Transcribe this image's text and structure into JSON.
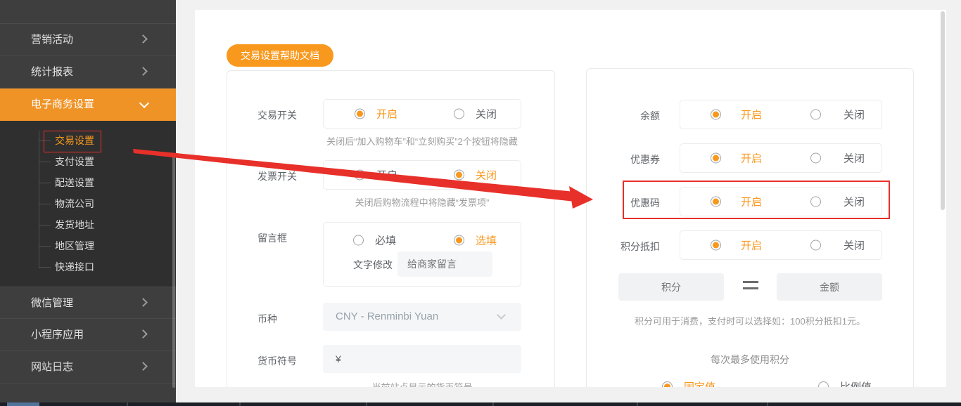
{
  "colors": {
    "accent": "#f8981d",
    "sidebar_active_bg": "#f09326",
    "annotation_red": "#e8302a"
  },
  "sidebar": {
    "items_top": [
      {
        "label": "营销活动"
      },
      {
        "label": "统计报表"
      }
    ],
    "active_item": {
      "label": "电子商务设置",
      "expanded": true
    },
    "submenu": [
      {
        "label": "交易设置",
        "current": true,
        "annotated": true
      },
      {
        "label": "支付设置"
      },
      {
        "label": "配送设置"
      },
      {
        "label": "物流公司"
      },
      {
        "label": "发货地址"
      },
      {
        "label": "地区管理"
      },
      {
        "label": "快递接口"
      }
    ],
    "items_bottom": [
      {
        "label": "微信管理"
      },
      {
        "label": "小程序应用"
      },
      {
        "label": "网站日志"
      }
    ]
  },
  "content": {
    "help_button": "交易设置帮助文档",
    "left_panel": {
      "trade_switch": {
        "label": "交易开关",
        "on": "开启",
        "off": "关闭",
        "selected": "on",
        "helper": "关闭后“加入购物车”和“立刻购买”2个按钮将隐藏"
      },
      "invoice_switch": {
        "label": "发票开关",
        "on": "开启",
        "off": "关闭",
        "selected": "off",
        "helper": "关闭后购物流程中将隐藏“发票项”"
      },
      "message_box": {
        "label": "留言框",
        "required": "必填",
        "optional": "选填",
        "selected": "optional",
        "edit_label": "文字修改",
        "placeholder": "给商家留言"
      },
      "currency": {
        "label": "币种",
        "value": "CNY - Renminbi Yuan"
      },
      "currency_symbol": {
        "label": "货币符号",
        "value": "¥",
        "helper": "当前站点显示的货币符号"
      }
    },
    "right_panel": {
      "balance": {
        "label": "余额",
        "on": "开启",
        "off": "关闭",
        "selected": "on"
      },
      "coupon": {
        "label": "优惠券",
        "on": "开启",
        "off": "关闭",
        "selected": "on"
      },
      "promo_code": {
        "label": "优惠码",
        "on": "开启",
        "off": "关闭",
        "selected": "on",
        "annotated": true
      },
      "points_deduction": {
        "label": "积分抵扣",
        "on": "开启",
        "off": "关闭",
        "selected": "on"
      },
      "points_exchange": {
        "points_placeholder": "积分",
        "equals": "=",
        "amount_placeholder": "金额",
        "helper": "积分可用于消费，支付时可以选择如：100积分抵扣1元。"
      },
      "points_limit": {
        "title": "每次最多使用积分",
        "fixed": "固定值",
        "ratio": "比例值",
        "selected": "fixed"
      }
    }
  }
}
